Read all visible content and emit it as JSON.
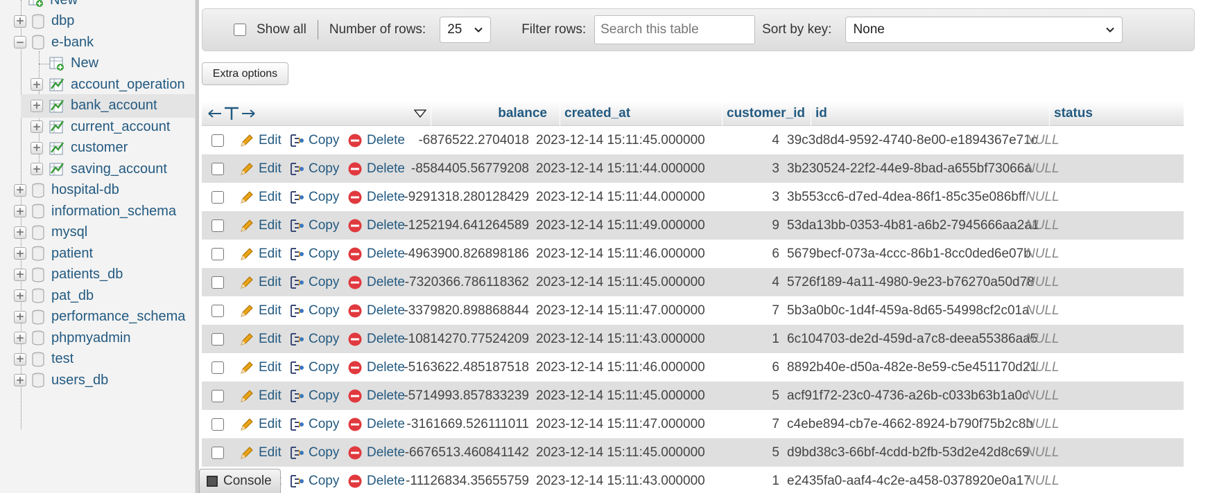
{
  "sidebar": {
    "top_partial": "New",
    "databases": [
      {
        "label": "dbp",
        "expanded": false
      },
      {
        "label": "e-bank",
        "expanded": true,
        "children": [
          {
            "label": "New",
            "type": "new"
          },
          {
            "label": "account_operation",
            "type": "table"
          },
          {
            "label": "bank_account",
            "type": "table",
            "active": true
          },
          {
            "label": "current_account",
            "type": "table"
          },
          {
            "label": "customer",
            "type": "table"
          },
          {
            "label": "saving_account",
            "type": "table"
          }
        ]
      },
      {
        "label": "hospital-db",
        "expanded": false
      },
      {
        "label": "information_schema",
        "expanded": false
      },
      {
        "label": "mysql",
        "expanded": false
      },
      {
        "label": "patient",
        "expanded": false
      },
      {
        "label": "patients_db",
        "expanded": false
      },
      {
        "label": "pat_db",
        "expanded": false
      },
      {
        "label": "performance_schema",
        "expanded": false
      },
      {
        "label": "phpmyadmin",
        "expanded": false
      },
      {
        "label": "test",
        "expanded": false
      },
      {
        "label": "users_db",
        "expanded": false
      }
    ]
  },
  "navbar": {
    "show_all": "Show all",
    "number_of_rows_label": "Number of rows:",
    "number_of_rows_value": "25",
    "filter_rows_label": "Filter rows:",
    "filter_placeholder": "Search this table",
    "sort_by_key_label": "Sort by key:",
    "sort_by_key_value": "None"
  },
  "extra_options": "Extra options",
  "table": {
    "columns": [
      "balance",
      "created_at",
      "customer_id",
      "id",
      "status"
    ],
    "actions": {
      "edit": "Edit",
      "copy": "Copy",
      "delete": "Delete"
    },
    "rows": [
      {
        "balance": "-6876522.2704018",
        "created_at": "2023-12-14 15:11:45.000000",
        "customer_id": "4",
        "id": "39c3d8d4-9592-4740-8e00-e1894367e71c",
        "status": "NULL"
      },
      {
        "balance": "-8584405.56779208",
        "created_at": "2023-12-14 15:11:44.000000",
        "customer_id": "3",
        "id": "3b230524-22f2-44e9-8bad-a655bf73066a",
        "status": "NULL"
      },
      {
        "balance": "-9291318.280128429",
        "created_at": "2023-12-14 15:11:44.000000",
        "customer_id": "3",
        "id": "3b553cc6-d7ed-4dea-86f1-85c35e086bff",
        "status": "NULL"
      },
      {
        "balance": "-1252194.641264589",
        "created_at": "2023-12-14 15:11:49.000000",
        "customer_id": "9",
        "id": "53da13bb-0353-4b81-a6b2-7945666aa2a1",
        "status": "NULL"
      },
      {
        "balance": "-4963900.826898186",
        "created_at": "2023-12-14 15:11:46.000000",
        "customer_id": "6",
        "id": "5679becf-073a-4ccc-86b1-8cc0ded6e07b",
        "status": "NULL"
      },
      {
        "balance": "-7320366.786118362",
        "created_at": "2023-12-14 15:11:45.000000",
        "customer_id": "4",
        "id": "5726f189-4a11-4980-9e23-b76270a50d78",
        "status": "NULL"
      },
      {
        "balance": "-3379820.898868844",
        "created_at": "2023-12-14 15:11:47.000000",
        "customer_id": "7",
        "id": "5b3a0b0c-1d4f-459a-8d65-54998cf2c01a",
        "status": "NULL"
      },
      {
        "balance": "-10814270.77524209",
        "created_at": "2023-12-14 15:11:43.000000",
        "customer_id": "1",
        "id": "6c104703-de2d-459d-a7c8-deea55386aa5",
        "status": "NULL"
      },
      {
        "balance": "-5163622.485187518",
        "created_at": "2023-12-14 15:11:46.000000",
        "customer_id": "6",
        "id": "8892b40e-d50a-482e-8e59-c5e451170d21",
        "status": "NULL"
      },
      {
        "balance": "-5714993.857833239",
        "created_at": "2023-12-14 15:11:45.000000",
        "customer_id": "5",
        "id": "acf91f72-23c0-4736-a26b-c033b63b1a0c",
        "status": "NULL"
      },
      {
        "balance": "-3161669.526111011",
        "created_at": "2023-12-14 15:11:47.000000",
        "customer_id": "7",
        "id": "c4ebe894-cb7e-4662-8924-b790f75b2c8b",
        "status": "NULL"
      },
      {
        "balance": "-6676513.460841142",
        "created_at": "2023-12-14 15:11:45.000000",
        "customer_id": "5",
        "id": "d9bd38c3-66bf-4cdd-b2fb-53d2e42d8c69",
        "status": "NULL"
      },
      {
        "balance": "-11126834.35655759",
        "created_at": "2023-12-14 15:11:43.000000",
        "customer_id": "1",
        "id": "e2435fa0-aaf4-4c2e-a458-0378920e0a17",
        "status": "NULL"
      }
    ]
  },
  "console": "Console",
  "colors": {
    "link": "#235a81",
    "row_alt": "#dfdfdf",
    "delete_red": "#e0393e",
    "pencil": "#e8a317"
  }
}
